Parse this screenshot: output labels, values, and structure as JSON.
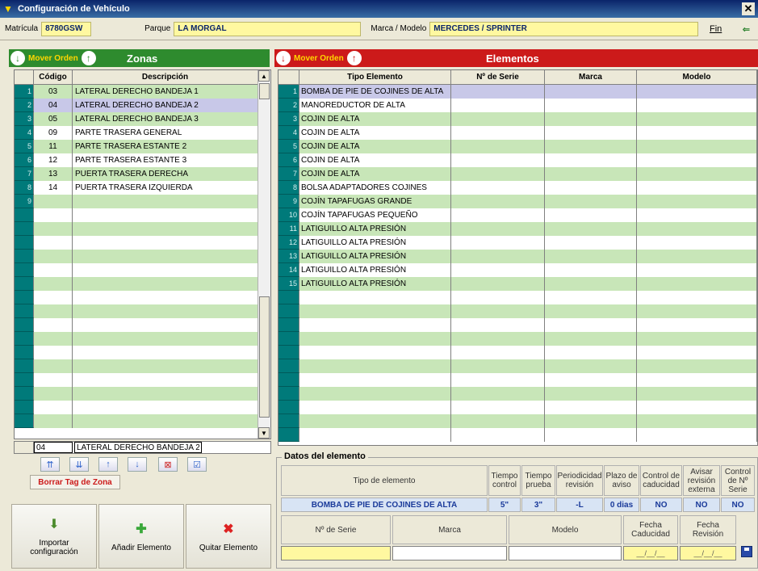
{
  "window": {
    "title": "Configuración de Vehículo"
  },
  "info": {
    "matricula_label": "Matrícula",
    "matricula_value": "8780GSW",
    "parque_label": "Parque",
    "parque_value": "LA MORGAL",
    "marca_label": "Marca / Modelo",
    "marca_value": "MERCEDES / SPRINTER",
    "fin_label": "Fin"
  },
  "zonas": {
    "mover_label": "Mover Orden",
    "title": "Zonas",
    "col_codigo": "Código",
    "col_descripcion": "Descripción",
    "rows": [
      {
        "n": "1",
        "codigo": "03",
        "desc": "LATERAL DERECHO BANDEJA 1"
      },
      {
        "n": "2",
        "codigo": "04",
        "desc": "LATERAL DERECHO BANDEJA 2"
      },
      {
        "n": "3",
        "codigo": "05",
        "desc": "LATERAL DERECHO BANDEJA 3"
      },
      {
        "n": "4",
        "codigo": "09",
        "desc": "PARTE TRASERA GENERAL"
      },
      {
        "n": "5",
        "codigo": "11",
        "desc": "PARTE TRASERA ESTANTE 2"
      },
      {
        "n": "6",
        "codigo": "12",
        "desc": "PARTE TRASERA ESTANTE 3"
      },
      {
        "n": "7",
        "codigo": "13",
        "desc": "PUERTA TRASERA DERECHA"
      },
      {
        "n": "8",
        "codigo": "14",
        "desc": "PUERTA TRASERA IZQUIERDA"
      },
      {
        "n": "9",
        "codigo": "",
        "desc": ""
      }
    ],
    "edit_codigo": "04",
    "edit_desc": "LATERAL DERECHO BANDEJA 2",
    "borrar_label": "Borrar Tag de Zona"
  },
  "buttons": {
    "importar": "Importar configuración",
    "anadir": "Añadir Elemento",
    "quitar": "Quitar Elemento"
  },
  "elementos": {
    "mover_label": "Mover Orden",
    "title": "Elementos",
    "col_tipo": "Tipo Elemento",
    "col_serie": "Nº de Serie",
    "col_marca": "Marca",
    "col_modelo": "Modelo",
    "rows": [
      {
        "n": "1",
        "tipo": "BOMBA DE PIE DE COJINES DE ALTA"
      },
      {
        "n": "2",
        "tipo": "MANOREDUCTOR DE ALTA"
      },
      {
        "n": "3",
        "tipo": "COJIN DE ALTA"
      },
      {
        "n": "4",
        "tipo": "COJIN DE ALTA"
      },
      {
        "n": "5",
        "tipo": "COJIN DE ALTA"
      },
      {
        "n": "6",
        "tipo": "COJIN DE ALTA"
      },
      {
        "n": "7",
        "tipo": "COJIN DE ALTA"
      },
      {
        "n": "8",
        "tipo": "BOLSA ADAPTADORES COJINES"
      },
      {
        "n": "9",
        "tipo": "COJÍN TAPAFUGAS GRANDE"
      },
      {
        "n": "10",
        "tipo": "COJÍN TAPAFUGAS PEQUEÑO"
      },
      {
        "n": "11",
        "tipo": "LATIGUILLO ALTA PRESIÓN"
      },
      {
        "n": "12",
        "tipo": "LATIGUILLO ALTA PRESIÓN"
      },
      {
        "n": "13",
        "tipo": "LATIGUILLO ALTA PRESIÓN"
      },
      {
        "n": "14",
        "tipo": "LATIGUILLO ALTA PRESIÓN"
      },
      {
        "n": "15",
        "tipo": "LATIGUILLO ALTA PRESIÓN"
      }
    ]
  },
  "datos": {
    "legend": "Datos del elemento",
    "h_tipo": "Tipo de elemento",
    "h_tcontrol": "Tiempo control",
    "h_tprueba": "Tiempo prueba",
    "h_period": "Periodicidad revisión",
    "h_plazo": "Plazo de aviso",
    "h_ccad": "Control de caducidad",
    "h_avisar": "Avisar revisión externa",
    "h_cserie": "Control de Nº Serie",
    "v_tipo": "BOMBA DE PIE DE COJINES DE ALTA",
    "v_tcontrol": "5\"",
    "v_tprueba": "3\"",
    "v_period": "-L",
    "v_plazo": "0 dias",
    "v_ccad": "NO",
    "v_avisar": "NO",
    "v_cserie": "NO",
    "h_serie": "Nº de Serie",
    "h_marca": "Marca",
    "h_modelo": "Modelo",
    "h_fcad": "Fecha Caducidad",
    "h_frev": "Fecha Revisión",
    "fcad_value": "__/__/__",
    "frev_value": "__/__/__"
  },
  "colors": {
    "zonas_bar": "#2e8b2e",
    "elementos_bar": "#cc1a1a",
    "row_green": "#c8e6b8",
    "rownum": "#007a7a"
  }
}
